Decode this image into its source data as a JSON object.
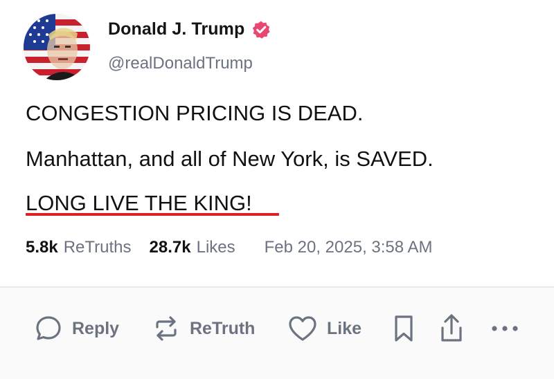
{
  "author": {
    "display_name": "Donald J. Trump",
    "handle": "@realDonaldTrump",
    "verified": true,
    "avatar_icon": "avatar-flag-portrait",
    "verified_icon": "verified-badge-icon",
    "verified_color": "#e8486f"
  },
  "post": {
    "lines": [
      "CONGESTION PRICING IS DEAD.",
      "Manhattan, and all of New York, is SAVED.",
      "LONG LIVE THE KING!"
    ],
    "underline_color": "#e02020"
  },
  "stats": {
    "retruths_count": "5.8k",
    "retruths_label": "ReTruths",
    "likes_count": "28.7k",
    "likes_label": "Likes",
    "timestamp": "Feb 20, 2025, 3:58 AM"
  },
  "actions": {
    "reply_label": "Reply",
    "retruth_label": "ReTruth",
    "like_label": "Like",
    "icons": [
      "reply-icon",
      "retruth-icon",
      "like-icon",
      "bookmark-icon",
      "share-icon",
      "more-icon"
    ]
  },
  "colors": {
    "text": "#111111",
    "muted": "#6b7280",
    "accent": "#e02020"
  }
}
